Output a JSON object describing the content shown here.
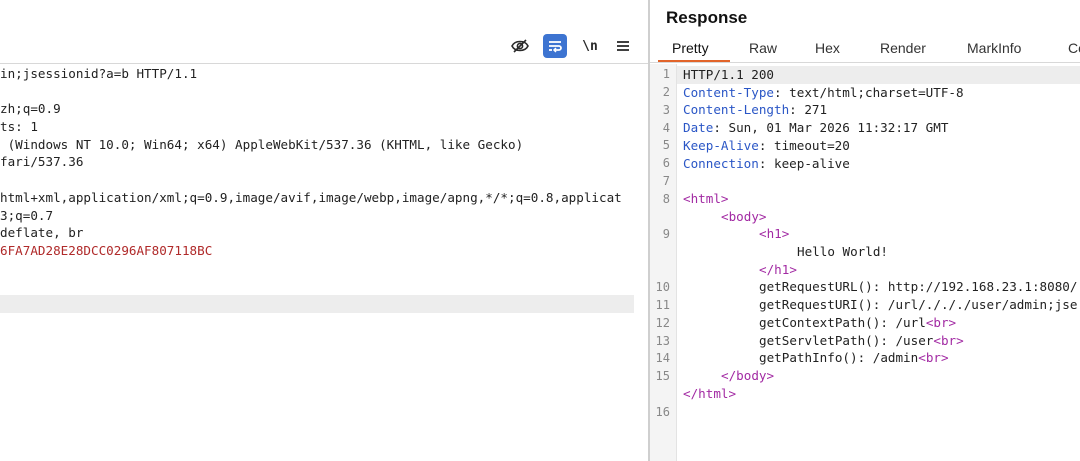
{
  "request": {
    "lines": [
      "in;jsessionid?a=b HTTP/1.1",
      "",
      "zh;q=0.9",
      "ts: 1",
      " (Windows NT 10.0; Win64; x64) AppleWebKit/537.36 (KHTML, like Gecko)",
      "fari/537.36",
      "",
      "html+xml,application/xml;q=0.9,image/avif,image/webp,image/apng,*/*;q=0.8,applicat",
      "3;q=0.7",
      "deflate, br",
      "6FA7AD28E28DCC0296AF807118BC"
    ],
    "toolbar": {
      "hide_icon": "eye-slash-icon",
      "wrap_icon": "wrap-lines-icon",
      "newline_label": "\\n",
      "menu_icon": "hamburger-menu-icon"
    }
  },
  "response": {
    "title": "Response",
    "tabs": [
      "Pretty",
      "Raw",
      "Hex",
      "Render",
      "MarkInfo",
      "Co"
    ],
    "active_tab": "Pretty",
    "status_line": "HTTP/1.1 200",
    "headers": [
      {
        "name": "Content-Type",
        "value": " text/html;charset=UTF-8"
      },
      {
        "name": "Content-Length",
        "value": " 271"
      },
      {
        "name": "Date",
        "value": " Sun, 01 Mar 2026 11:32:17 GMT"
      },
      {
        "name": "Keep-Alive",
        "value": " timeout=20"
      },
      {
        "name": "Connection",
        "value": " keep-alive"
      }
    ],
    "body": {
      "html_open": "<html>",
      "body_open": "<body>",
      "h1_open": "<h1>",
      "hello": "Hello World!",
      "h1_close": "</h1>",
      "url_line": "getRequestURL(): http://192.168.23.1:8080/",
      "uri_line": "getRequestURI(): /url/./././user/admin;jse",
      "context_line": "getContextPath(): /url",
      "servlet_line": "getServletPath(): /user",
      "pathinfo_line": "getPathInfo(): /admin",
      "br": "<br>",
      "body_close": "</body>",
      "html_close": "</html>"
    },
    "line_numbers": [
      "1",
      "2",
      "3",
      "4",
      "5",
      "6",
      "7",
      "8",
      "9",
      "10",
      "11",
      "12",
      "13",
      "14",
      "15",
      "16"
    ],
    "colors": {
      "header_name": "#2a56c6",
      "tag": "#a22aa3",
      "tab_accent": "#e2642a",
      "cookie_value": "#b02a2a"
    }
  }
}
